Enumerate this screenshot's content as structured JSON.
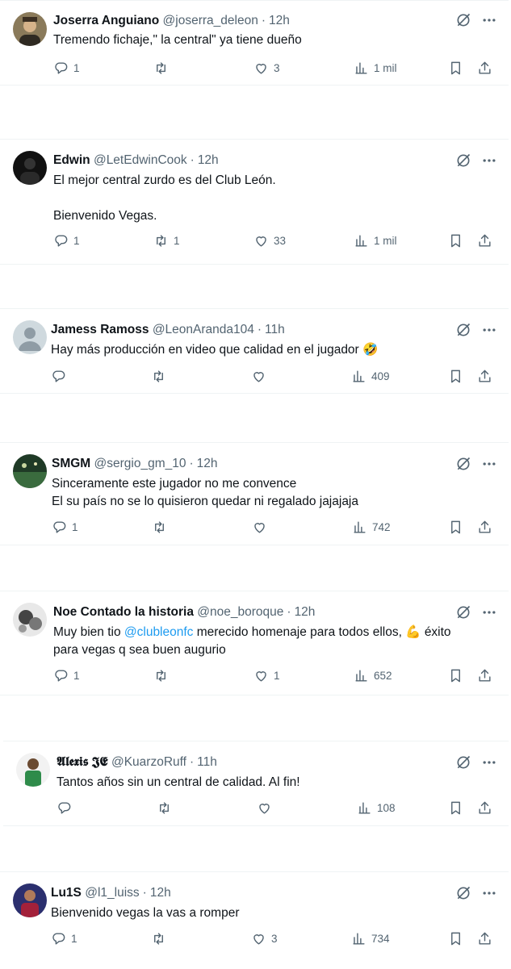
{
  "tweets": [
    {
      "name": "Joserra Anguiano",
      "handle": "@joserra_deleon",
      "time": "12h",
      "text": "Tremendo fichaje,\" la central\" ya tiene dueño",
      "replies": "1",
      "retweets": "",
      "likes": "3",
      "views": "1 mil",
      "avatar": "#6b5a3c"
    },
    {
      "name": "Edwin",
      "handle": "@LetEdwinCook",
      "time": "12h",
      "text": "El mejor central zurdo es del Club León.\n\nBienvenido Vegas.",
      "replies": "1",
      "retweets": "1",
      "likes": "33",
      "views": "1 mil",
      "avatar": "#1b1b1b"
    },
    {
      "name": "Jamess Ramoss",
      "handle": "@LeonAranda104",
      "time": "11h",
      "text": "Hay más producción en video que calidad en el jugador 🤣",
      "replies": "",
      "retweets": "",
      "likes": "",
      "views": "409",
      "avatar": "#cfd9de"
    },
    {
      "name": "SMGM",
      "handle": "@sergio_gm_10",
      "time": "12h",
      "text": "Sinceramente este jugador no me convence\nEl su país no se lo quisieron quedar ni regalado jajajaja",
      "replies": "1",
      "retweets": "",
      "likes": "",
      "views": "742",
      "avatar": "#2d4a2f"
    },
    {
      "name": "Noe Contado la historia",
      "handle": "@noe_boroque",
      "time": "12h",
      "text_before": "Muy bien tio ",
      "mention": "@clubleonfc",
      "text_after": " merecido homenaje para todos ellos, 💪 éxito para vegas q sea buen augurio",
      "replies": "1",
      "retweets": "",
      "likes": "1",
      "views": "652",
      "avatar": "#9aa1a5"
    },
    {
      "name": "𝕬𝖑𝖊𝖝𝖎𝖘 𝕵𝕰",
      "handle": "@KuarzoRuff",
      "time": "11h",
      "text": "Tantos años sin un central de calidad. Al fin!",
      "replies": "",
      "retweets": "",
      "likes": "",
      "views": "108",
      "avatar": "#3f7d4e"
    },
    {
      "name": "Lu1S",
      "handle": "@l1_luiss",
      "time": "12h",
      "text": "Bienvenido vegas la vas a romper",
      "replies": "1",
      "retweets": "",
      "likes": "3",
      "views": "734",
      "avatar": "#3a3f7a"
    }
  ]
}
